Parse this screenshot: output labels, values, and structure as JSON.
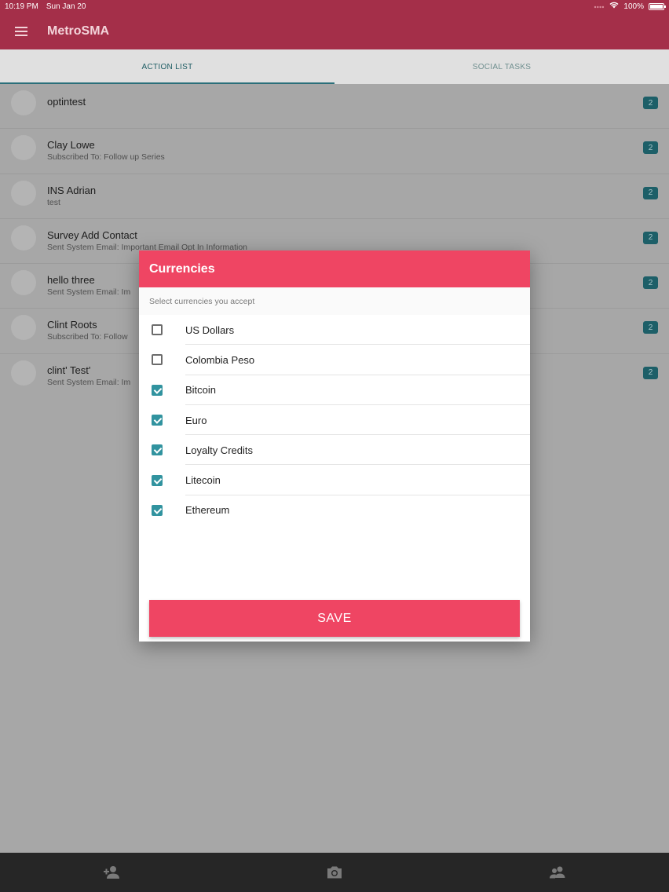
{
  "statusbar": {
    "time": "10:19 PM",
    "date": "Sun Jan 20",
    "battery": "100%",
    "icons": [
      "signal-dots-icon",
      "wifi-icon",
      "battery-icon"
    ]
  },
  "appbar": {
    "title": "MetroSMA",
    "menu_icon": "hamburger-menu-icon"
  },
  "tabs": [
    {
      "label": "ACTION LIST",
      "active": true
    },
    {
      "label": "SOCIAL TASKS",
      "active": false
    }
  ],
  "contacts": [
    {
      "name": "optintest",
      "subtitle": "",
      "badge": "2"
    },
    {
      "name": "Clay Lowe",
      "subtitle": "Subscribed To: Follow up Series",
      "badge": "2"
    },
    {
      "name": "INS Adrian",
      "subtitle": "test",
      "badge": "2"
    },
    {
      "name": "Survey Add Contact",
      "subtitle": "Sent System Email: Important Email Opt In Information",
      "badge": "2"
    },
    {
      "name": "hello three",
      "subtitle": "Sent System Email: Im",
      "badge": "2"
    },
    {
      "name": "Clint Roots",
      "subtitle": "Subscribed To: Follow",
      "badge": "2"
    },
    {
      "name": "clint' Test'",
      "subtitle": "Sent System Email: Im",
      "badge": "2"
    }
  ],
  "dialog": {
    "title": "Currencies",
    "subtitle": "Select currencies you accept",
    "currencies": [
      {
        "label": "US Dollars",
        "checked": false
      },
      {
        "label": "Colombia Peso",
        "checked": false
      },
      {
        "label": "Bitcoin",
        "checked": true
      },
      {
        "label": "Euro",
        "checked": true
      },
      {
        "label": "Loyalty Credits",
        "checked": true
      },
      {
        "label": "Litecoin",
        "checked": true
      },
      {
        "label": "Ethereum",
        "checked": true
      }
    ],
    "save_label": "SAVE"
  },
  "bottombar": {
    "icons": [
      "add-person-icon",
      "camera-icon",
      "group-icon"
    ]
  },
  "colors": {
    "primary": "#ef4563",
    "appbar": "#a42f49",
    "accent": "#31939f",
    "badge": "#1d5f68",
    "bottombar": "#262626"
  }
}
